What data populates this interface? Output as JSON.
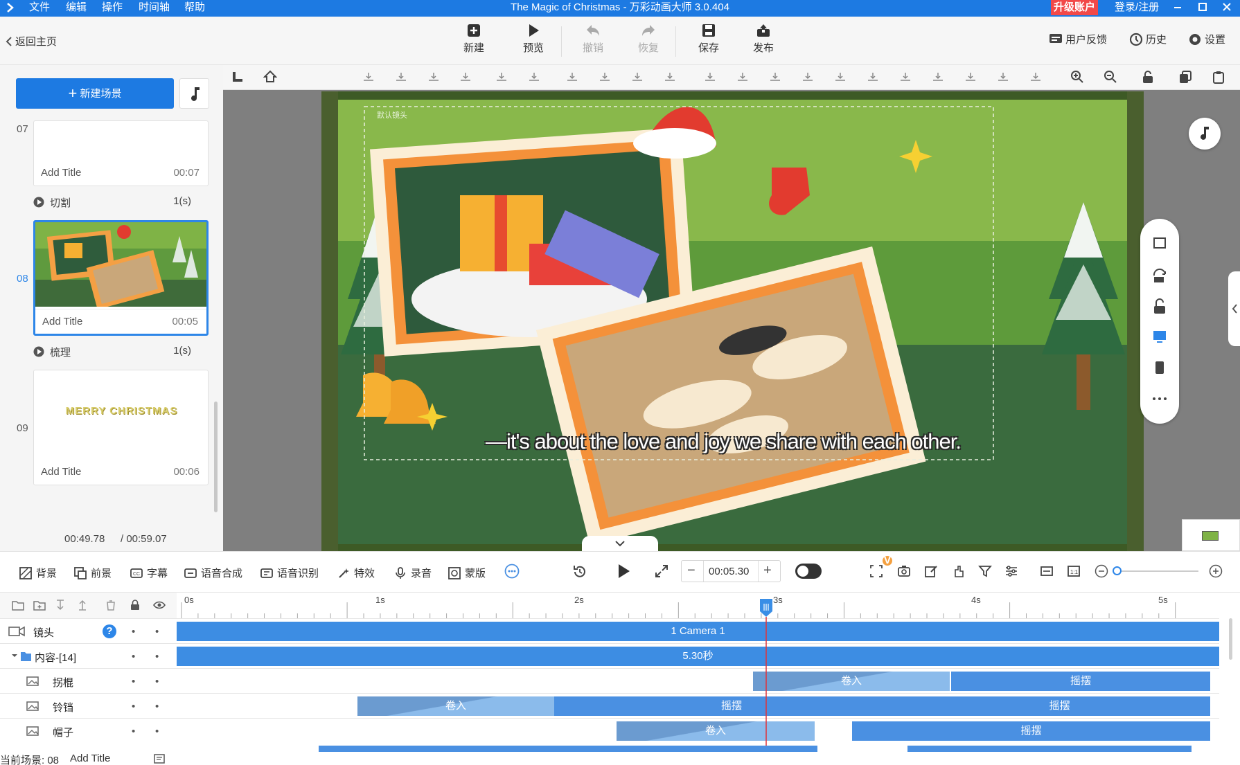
{
  "menu": {
    "items": [
      "文件",
      "编辑",
      "操作",
      "时间轴",
      "帮助"
    ]
  },
  "window": {
    "title": "The Magic of Christmas - 万彩动画大师 3.0.404",
    "upgrade": "升级账户",
    "login": "登录/注册"
  },
  "toolbar": {
    "back": "返回主页",
    "new": "新建",
    "preview": "预览",
    "undo": "撤销",
    "redo": "恢复",
    "save": "保存",
    "publish": "发布",
    "feedback": "用户反馈",
    "history": "历史",
    "settings": "设置"
  },
  "scenes": {
    "new_scene": "新建场景",
    "items": [
      {
        "num": "07",
        "title": "Add Title",
        "duration": "00:07"
      },
      {
        "num": "08",
        "title": "Add Title",
        "duration": "00:05"
      },
      {
        "num": "09",
        "title": "Add Title",
        "duration": "00:06",
        "thumb_text": "MERRY CHRISTMAS"
      }
    ],
    "transitions": [
      {
        "name": "切割",
        "duration": "1(s)"
      },
      {
        "name": "梳理",
        "duration": "1(s)"
      }
    ],
    "time_current": "00:49.78",
    "time_total": "/ 00:59.07"
  },
  "canvas": {
    "subtitle": "—it's about the love and joy we share with each other.",
    "camera_label": "默认镜头"
  },
  "bottom_tools": {
    "background": "背景",
    "foreground": "前景",
    "caption": "字幕",
    "tts": "语音合成",
    "asr": "语音识别",
    "effects": "特效",
    "record": "录音",
    "mask": "蒙版",
    "time": "00:05.30",
    "v_badge": "V"
  },
  "timeline": {
    "ticks": [
      "0s",
      "1s",
      "2s",
      "3s",
      "4s",
      "5s"
    ],
    "progress": 0.6,
    "rows": [
      {
        "name": "镜头",
        "bars": [
          {
            "label": "1 Camera 1"
          }
        ]
      },
      {
        "name": "内容-[14]",
        "bars": [
          {
            "label": "5.30秒"
          }
        ]
      },
      {
        "name": "拐棍",
        "bars": [
          {
            "label": "卷入"
          },
          {
            "label": "摇摆"
          }
        ]
      },
      {
        "name": "铃铛",
        "bars": [
          {
            "label": "卷入"
          },
          {
            "label": "摇摆"
          },
          {
            "label": "摇摆"
          }
        ]
      },
      {
        "name": "帽子",
        "bars": [
          {
            "label": "卷入"
          },
          {
            "label": "摇摆"
          }
        ]
      }
    ]
  },
  "status": {
    "current_scene": "当前场景: 08",
    "title": "Add Title"
  },
  "colors": {
    "accent": "#1d7ae2",
    "upgrade": "#f24949",
    "playhead": "#e0333a",
    "track": "#4a90e2"
  }
}
